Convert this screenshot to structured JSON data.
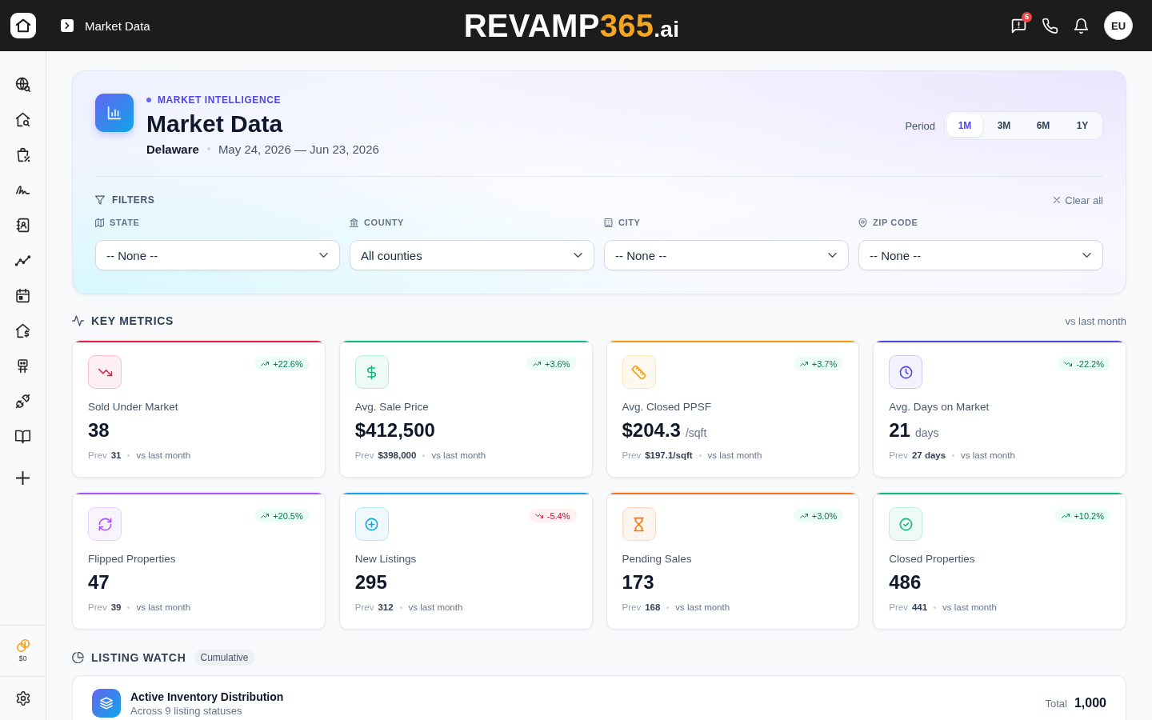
{
  "topbar": {
    "page_title": "Market Data",
    "logo": {
      "word": "REVAMP",
      "accent": "365",
      "suffix": ".ai"
    },
    "chat_badge": "5",
    "avatar": "EU"
  },
  "sidebar": {
    "credits": "$0"
  },
  "header": {
    "eyebrow": "MARKET INTELLIGENCE",
    "title": "Market Data",
    "location": "Delaware",
    "date_range": "May 24, 2026 — Jun 23, 2026",
    "period_label": "Period",
    "periods": [
      {
        "label": "1M",
        "selected": true
      },
      {
        "label": "3M",
        "selected": false
      },
      {
        "label": "6M",
        "selected": false
      },
      {
        "label": "1Y",
        "selected": false
      }
    ]
  },
  "filters": {
    "title": "FILTERS",
    "clear": "Clear all",
    "fields": [
      {
        "label": "STATE",
        "value": "-- None --"
      },
      {
        "label": "COUNTY",
        "value": "All counties"
      },
      {
        "label": "CITY",
        "value": "-- None --"
      },
      {
        "label": "ZIP CODE",
        "value": "-- None --"
      }
    ]
  },
  "key_metrics": {
    "title": "KEY METRICS",
    "note": "vs last month",
    "cards": [
      {
        "label": "Sold Under Market",
        "value": "38",
        "prev_label": "Prev",
        "prev": "31",
        "compare": "vs last month",
        "change": "+22.6%",
        "rising": true,
        "good": true,
        "color": "#e11d48"
      },
      {
        "label": "Avg. Sale Price",
        "value": "$412,500",
        "prev_label": "Prev",
        "prev": "$398,000",
        "compare": "vs last month",
        "change": "+3.6%",
        "rising": true,
        "good": true,
        "color": "#10b981"
      },
      {
        "label": "Avg. Closed PPSF",
        "value": "$204.3",
        "unit": "/sqft",
        "prev_label": "Prev",
        "prev": "$197.1/sqft",
        "compare": "vs last month",
        "change": "+3.7%",
        "rising": true,
        "good": true,
        "color": "#f59e0b"
      },
      {
        "label": "Avg. Days on Market",
        "value": "21",
        "unit": "days",
        "prev_label": "Prev",
        "prev": "27 days",
        "compare": "vs last month",
        "change": "-22.2%",
        "rising": false,
        "good": true,
        "color": "#4f46e5"
      },
      {
        "label": "Flipped Properties",
        "value": "47",
        "prev_label": "Prev",
        "prev": "39",
        "compare": "vs last month",
        "change": "+20.5%",
        "rising": true,
        "good": true,
        "color": "#a855f7"
      },
      {
        "label": "New Listings",
        "value": "295",
        "prev_label": "Prev",
        "prev": "312",
        "compare": "vs last month",
        "change": "-5.4%",
        "rising": false,
        "good": false,
        "color": "#0ea5e9"
      },
      {
        "label": "Pending Sales",
        "value": "173",
        "prev_label": "Prev",
        "prev": "168",
        "compare": "vs last month",
        "change": "+3.0%",
        "rising": true,
        "good": true,
        "color": "#f97316"
      },
      {
        "label": "Closed Properties",
        "value": "486",
        "prev_label": "Prev",
        "prev": "441",
        "compare": "vs last month",
        "change": "+10.2%",
        "rising": true,
        "good": true,
        "color": "#10b981"
      }
    ]
  },
  "listing_watch": {
    "title": "LISTING WATCH",
    "tag": "Cumulative",
    "card": {
      "title": "Active Inventory Distribution",
      "subtitle": "Across 9 listing statuses",
      "total_label": "Total",
      "total": "1,000"
    }
  }
}
